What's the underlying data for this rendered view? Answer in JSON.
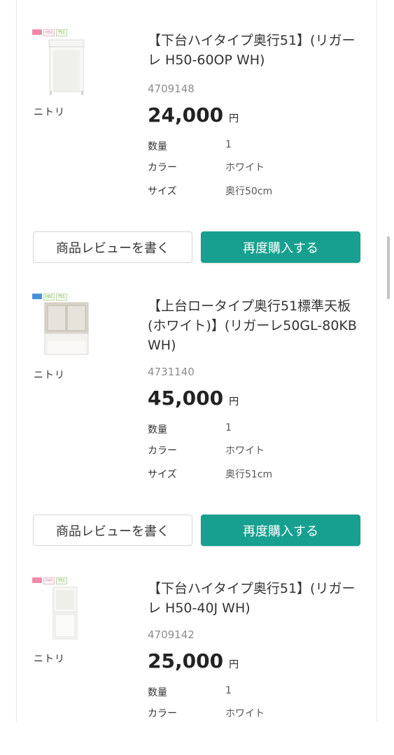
{
  "colors": {
    "accent": "#17a08f",
    "text": "#333333",
    "muted": "#8c8c8c"
  },
  "items": [
    {
      "image_name": "lower-cabinet-open-icon",
      "brand": "ニトリ",
      "title": "【下台ハイタイプ奥行51】(リガーレ H50-60OP WH)",
      "code": "4709148",
      "price": "24,000",
      "currency": "円",
      "specs": [
        {
          "label": "数量",
          "value": "1"
        },
        {
          "label": "カラー",
          "value": "ホワイト"
        },
        {
          "label": "サイズ",
          "value": "奥行50cm"
        }
      ],
      "review_label": "商品レビューを書く",
      "rebuy_label": "再度購入する"
    },
    {
      "image_name": "upper-cabinet-glass-icon",
      "brand": "ニトリ",
      "title": "【上台ロータイプ奥行51標準天板(ホワイト)】(リガーレ50GL-80KB WH)",
      "code": "4731140",
      "price": "45,000",
      "currency": "円",
      "specs": [
        {
          "label": "数量",
          "value": "1"
        },
        {
          "label": "カラー",
          "value": "ホワイト"
        },
        {
          "label": "サイズ",
          "value": "奥行51cm"
        }
      ],
      "review_label": "商品レビューを書く",
      "rebuy_label": "再度購入する"
    },
    {
      "image_name": "lower-cabinet-narrow-icon",
      "brand": "ニトリ",
      "title": "【下台ハイタイプ奥行51】(リガーレ H50-40J WH)",
      "code": "4709142",
      "price": "25,000",
      "currency": "円",
      "specs": [
        {
          "label": "数量",
          "value": "1"
        },
        {
          "label": "カラー",
          "value": "ホワイト"
        }
      ]
    }
  ]
}
